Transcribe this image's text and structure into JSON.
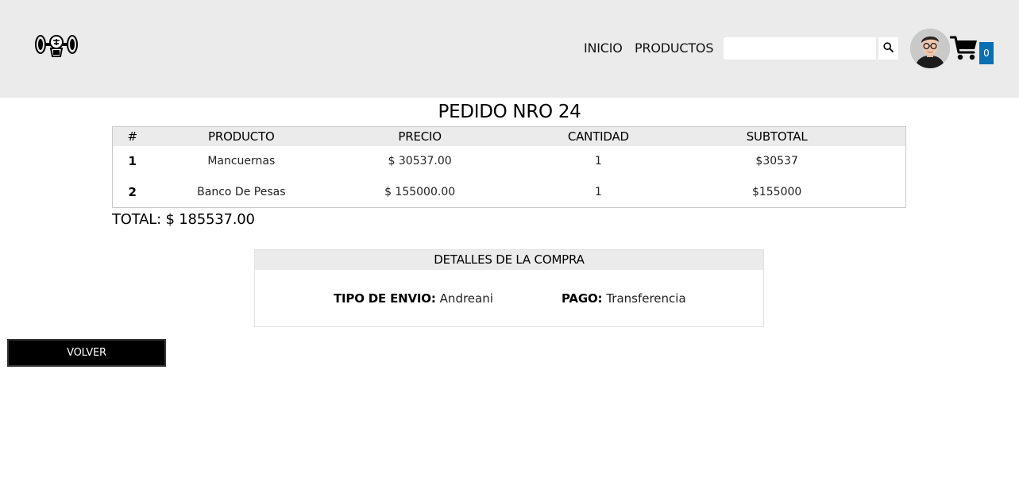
{
  "header": {
    "nav": {
      "inicio": "INICIO",
      "productos": "PRODUCTOS"
    },
    "search": {
      "value": "",
      "placeholder": ""
    },
    "cart_count": "0"
  },
  "order": {
    "title": "PEDIDO NRO 24",
    "columns": [
      "#",
      "PRODUCTO",
      "PRECIO",
      "CANTIDAD",
      "SUBTOTAL"
    ],
    "rows": [
      {
        "index": "1",
        "product": "Mancuernas",
        "price": "$ 30537.00",
        "quantity": "1",
        "subtotal": "$30537"
      },
      {
        "index": "2",
        "product": "Banco De Pesas",
        "price": "$ 155000.00",
        "quantity": "1",
        "subtotal": "$155000"
      }
    ],
    "total": "TOTAL: $ 185537.00"
  },
  "details": {
    "heading": "DETALLES DE LA COMPRA",
    "envio_label": "TIPO DE ENVIO:",
    "envio_value": "Andreani",
    "pago_label": "PAGO:",
    "pago_value": "Transferencia"
  },
  "back_button": "VOLVER",
  "icons": {
    "logo": "gym-dumbbell-logo",
    "search": "search-icon",
    "avatar": "user-avatar",
    "cart": "cart-icon"
  },
  "colors": {
    "header_bg": "#ebebeb",
    "badge_bg": "#0a6fb3",
    "button_bg": "#000000"
  }
}
